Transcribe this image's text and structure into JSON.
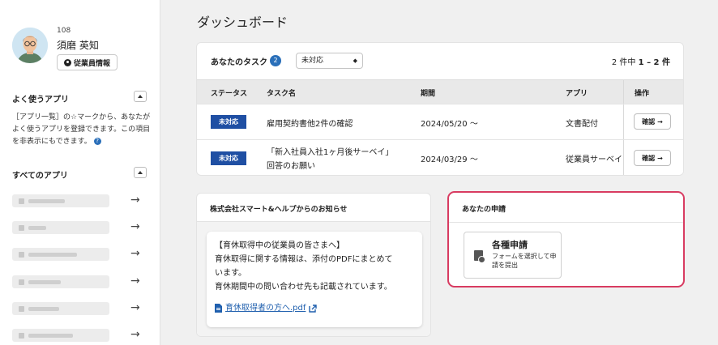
{
  "profile": {
    "employee_number": "108",
    "name": "須磨 英知",
    "employee_info_button": "従業員情報"
  },
  "sidebar": {
    "favorites_title": "よく使うアプリ",
    "favorites_description": "［アプリ一覧］の☆マークから、あなたがよく使うアプリを登録できます。この項目を非表示にもできます。",
    "all_apps_title": "すべてのアプリ",
    "apps_count_visible": 6,
    "arrow_glyph": "→"
  },
  "main": {
    "page_title": "ダッシュボード"
  },
  "tasks": {
    "title": "あなたのタスク",
    "badge_count": "2",
    "filter_value": "未対応",
    "count_prefix": "2 件中",
    "count_range": "1 – 2 件",
    "columns": [
      "ステータス",
      "タスク名",
      "期間",
      "アプリ",
      "操作"
    ],
    "rows": [
      {
        "status": "未対応",
        "name_line1": "雇用契約書他2件の確認",
        "name_line2": "",
        "period": "2024/05/20 〜",
        "app": "文書配付",
        "action": "確認"
      },
      {
        "status": "未対応",
        "name_line1": "「新入社員入社1ヶ月後サーベイ」",
        "name_line2": "回答のお願い",
        "period": "2024/03/29 〜",
        "app": "従業員サーベイ",
        "action": "確認"
      }
    ]
  },
  "notice": {
    "title": "株式会社スマート&ヘルプからのお知らせ",
    "line1": "【育休取得中の従業員の皆さまへ】",
    "line2": "育休取得に関する情報は、添付のPDFにまとめて",
    "line3": "います。",
    "line4": "育休期間中の問い合わせ先も記載されています。",
    "link_text": "育休取得者の方へ.pdf"
  },
  "applications": {
    "title": "あなたの申請",
    "tile_title": "各種申請",
    "tile_description": "フォームを選択して申請を提出",
    "highlight_color": "#d83b61"
  },
  "colors": {
    "accent": "#2a6fb9",
    "status_badge": "#1f4fa3",
    "link": "#1f5fae"
  }
}
